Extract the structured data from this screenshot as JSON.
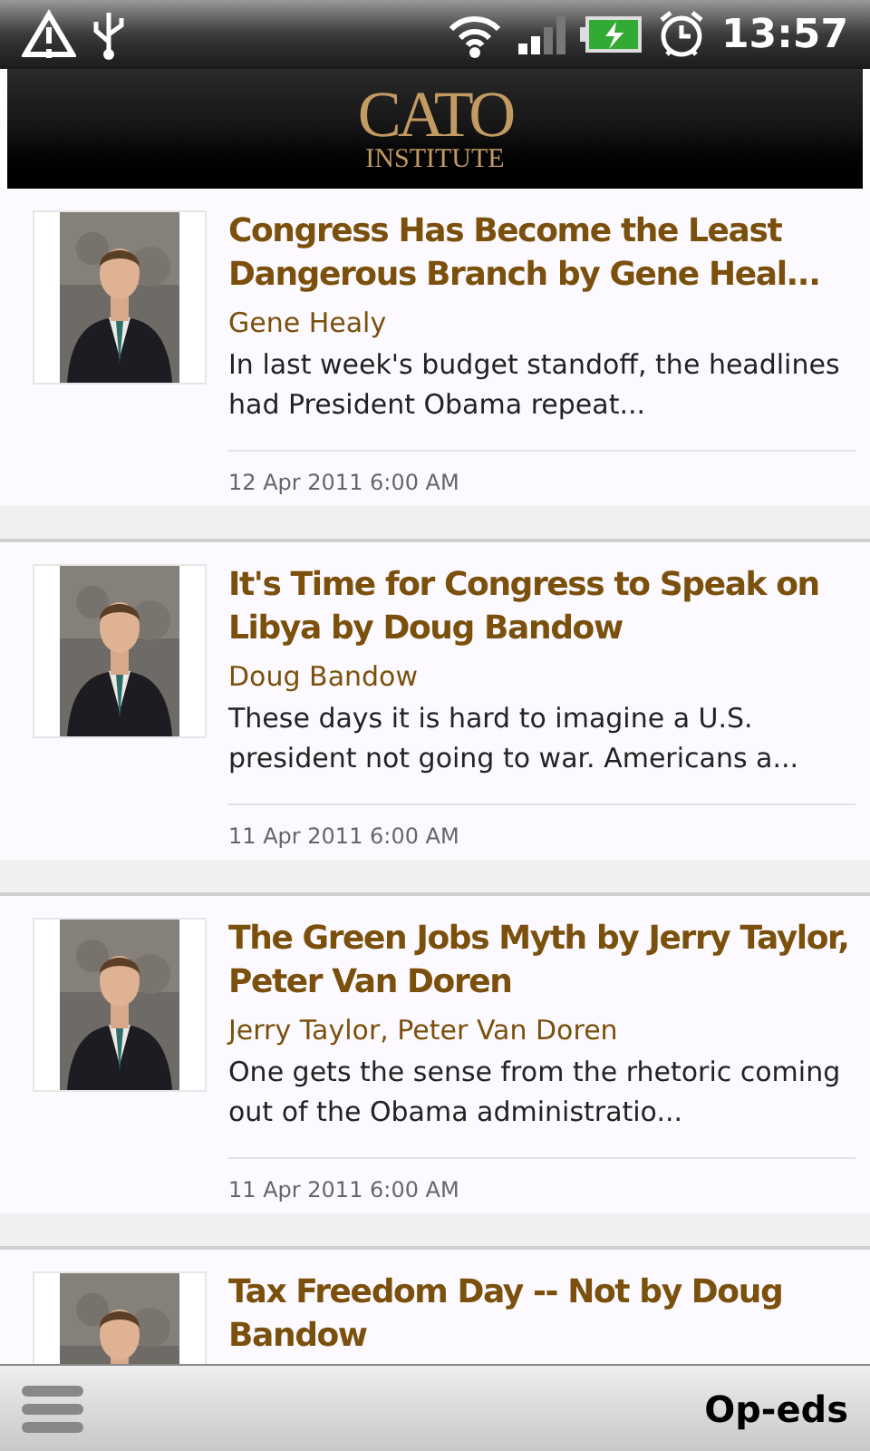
{
  "status_bar": {
    "time": "13:57"
  },
  "header": {
    "logo_top": "CATO",
    "logo_bottom": "INSTITUTE"
  },
  "articles": [
    {
      "title": "Congress Has Become the Least Dangerous Branch by Gene Heal...",
      "author": "Gene Healy",
      "snippet": "In last week's budget standoff, the headlines had President Obama repeat...",
      "date": "12 Apr 2011 6:00 AM"
    },
    {
      "title": "It's Time for Congress to Speak on Libya by Doug Bandow",
      "author": "Doug Bandow",
      "snippet": "These days it is hard to imagine a U.S. president not going to war. Americans a...",
      "date": "11 Apr 2011 6:00 AM"
    },
    {
      "title": "The Green Jobs Myth by Jerry Taylor, Peter Van Doren",
      "author": "Jerry Taylor, Peter Van Doren",
      "snippet": "One gets the sense from the rhetoric coming out of the Obama administratio...",
      "date": "11 Apr 2011 6:00 AM"
    },
    {
      "title": "Tax Freedom Day -- Not by Doug Bandow"
    }
  ],
  "bottom_bar": {
    "title": "Op-eds"
  }
}
